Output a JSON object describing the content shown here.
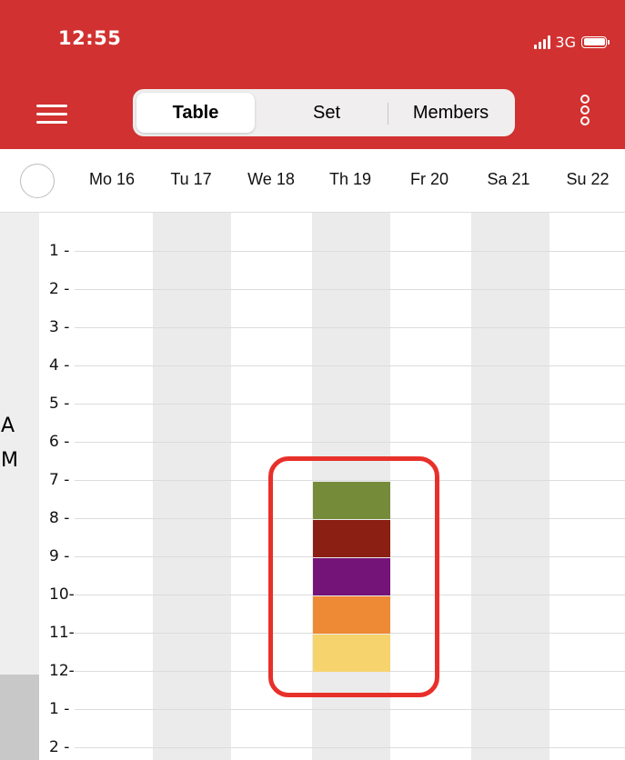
{
  "status_bar": {
    "time": "12:55",
    "network": "3G",
    "icons": [
      "signal-bars-icon",
      "battery-icon"
    ]
  },
  "nav": {
    "menu_icon": "hamburger-menu-icon",
    "more_icon": "more-vertical-icon",
    "tabs": [
      {
        "label": "Table",
        "active": true
      },
      {
        "label": "Set",
        "active": false
      },
      {
        "label": "Members",
        "active": false
      }
    ]
  },
  "days": [
    "Mo 16",
    "Tu 17",
    "We 18",
    "Th 19",
    "Fr 20",
    "Sa 21",
    "Su 22"
  ],
  "hours": [
    "1 -",
    "2 -",
    "3 -",
    "4 -",
    "5 -",
    "6 -",
    "7 -",
    "8 -",
    "9 -",
    "10-",
    "11-",
    "12-",
    "1 -",
    "2 -"
  ],
  "period_am": [
    "A",
    "M"
  ],
  "events": [
    {
      "day": "Th 19",
      "hour": 7,
      "color": "#768b3a"
    },
    {
      "day": "Th 19",
      "hour": 8,
      "color": "#8b1f13"
    },
    {
      "day": "Th 19",
      "hour": 9,
      "color": "#751478"
    },
    {
      "day": "Th 19",
      "hour": 10,
      "color": "#ee8935"
    },
    {
      "day": "Th 19",
      "hour": 11,
      "color": "#f6d36d"
    }
  ],
  "colors": {
    "brand": "#d13130",
    "highlight": "#e8302b",
    "shaded_column": "#ebebeb"
  }
}
